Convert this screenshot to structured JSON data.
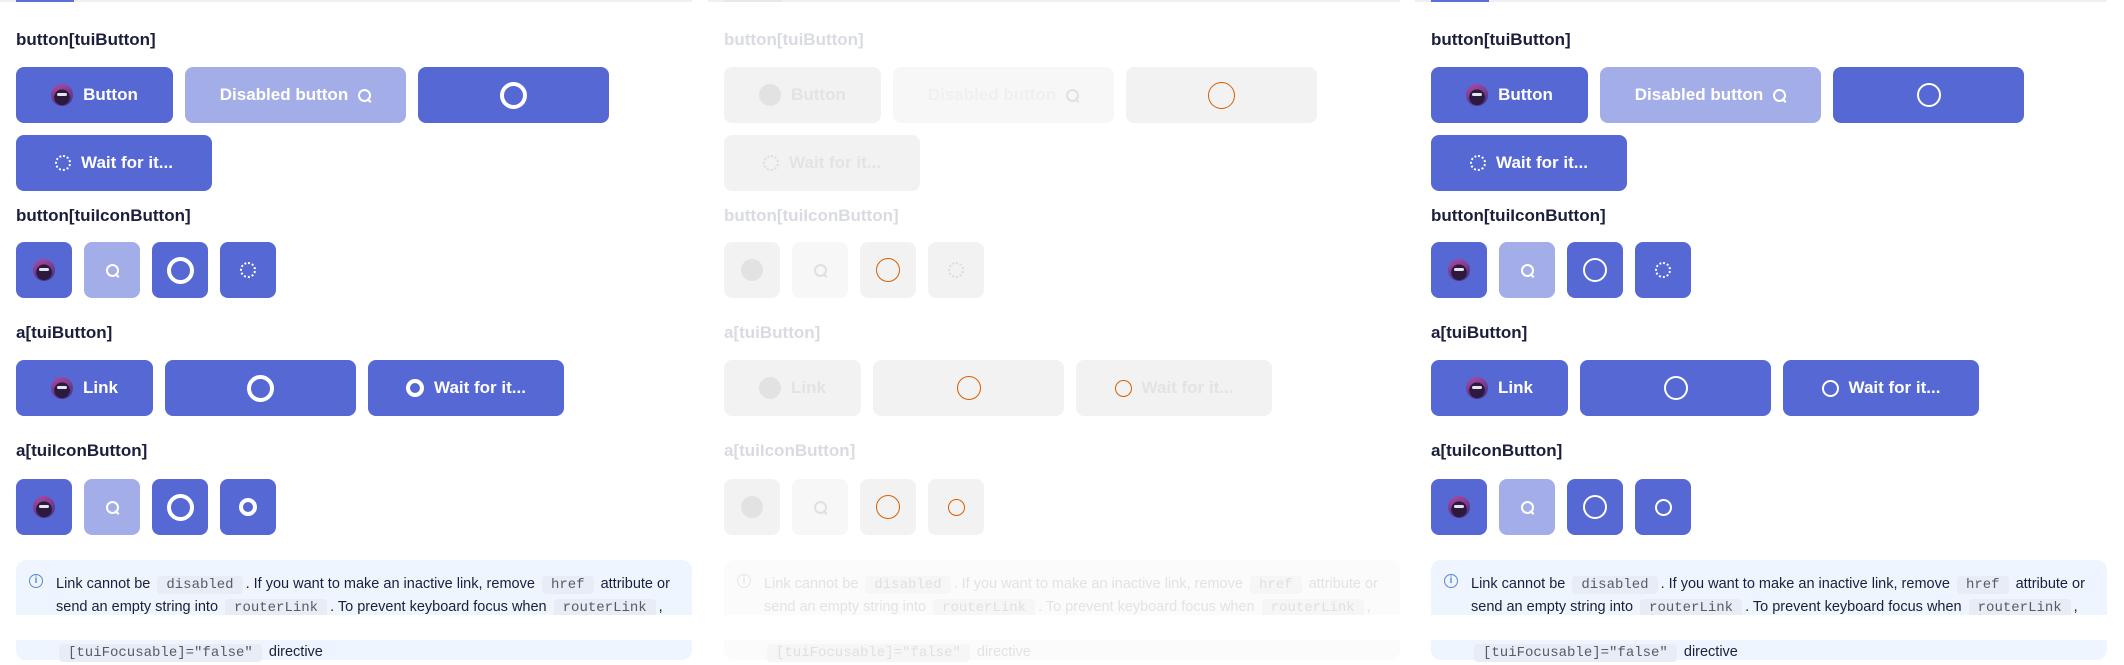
{
  "headings": {
    "button_tui": "button[tuiButton]",
    "button_icon": "button[tuiIconButton]",
    "a_tui": "a[tuiButton]",
    "a_icon": "a[tuiIconButton]"
  },
  "buttons": {
    "button_label": "Button",
    "disabled_label": "Disabled button",
    "wait_label": "Wait for it...",
    "link_label": "Link"
  },
  "notice": {
    "t1": "Link cannot be",
    "c1": "disabled",
    "t2": ". If you want to make an inactive link, remove",
    "c2": "href",
    "t3": "attribute or send an empty string into",
    "c3": "routerLink",
    "t4": ". To prevent keyboard focus when",
    "c4": "routerLink",
    "t5": ", use",
    "c5": "[tuiFocusable]=\"false\"",
    "t6": "directive"
  },
  "icons": {
    "avatar": "avatar-image",
    "search": "search-icon",
    "loader": "loader-ring-icon",
    "spinner": "spinner-icon",
    "info": "info-icon"
  },
  "colors": {
    "primary": "#5568d4",
    "primary_disabled": "#a3aee8",
    "notice_bg": "#eef5ff",
    "loader_outline_disabled_panel": "#d95f00"
  }
}
